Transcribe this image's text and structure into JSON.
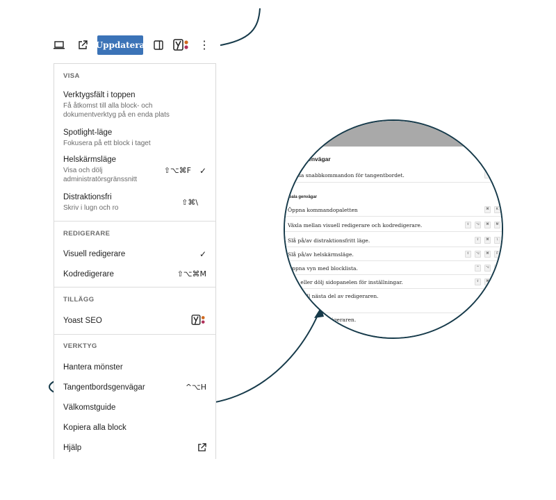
{
  "toolbar": {
    "preview_icon": "laptop-icon",
    "external_icon": "external-link-icon",
    "update_label": "Uppdatera",
    "sidebar_icon": "sidebar-toggle-icon",
    "yoast_icon": "yoast-icon",
    "more_icon": "vertical-ellipsis-icon"
  },
  "menu": {
    "visa": {
      "heading": "VISA",
      "items": [
        {
          "label": "Verktygsfält i toppen",
          "desc": "Få åtkomst till alla block- och dokumentverktyg på en enda plats",
          "shortcut": ""
        },
        {
          "label": "Spotlight-läge",
          "desc": "Fokusera på ett block i taget",
          "shortcut": ""
        },
        {
          "label": "Helskärmsläge",
          "desc": "Visa och dölj administratörsgränssnitt",
          "shortcut": "⇧⌥⌘F",
          "check": "✓"
        },
        {
          "label": "Distraktionsfri",
          "desc": "Skriv i lugn och ro",
          "shortcut": "⇧⌘\\"
        }
      ]
    },
    "redigerare": {
      "heading": "REDIGERARE",
      "items": [
        {
          "label": "Visuell redigerare",
          "shortcut": "✓"
        },
        {
          "label": "Kodredigerare",
          "shortcut": "⇧⌥⌘M"
        }
      ]
    },
    "tillagg": {
      "heading": "TILLÄGG",
      "items": [
        {
          "label": "Yoast SEO",
          "icon": "yoast-icon"
        }
      ]
    },
    "verktyg": {
      "heading": "VERKTYG",
      "items": [
        {
          "label": "Hantera mönster",
          "shortcut": ""
        },
        {
          "label": "Tangentbordsgenvägar",
          "shortcut": "^⌥H"
        },
        {
          "label": "Välkomstguide",
          "shortcut": ""
        },
        {
          "label": "Kopiera alla block",
          "shortcut": ""
        },
        {
          "label": "Hjälp",
          "icon": "external-link-icon"
        }
      ]
    }
  },
  "zoom": {
    "title": "dsgenvägar",
    "subtitle": "dessa snabbkommandon för tangentbordet.",
    "section": "obala genvägar",
    "rows": [
      {
        "text": "Öppna kommandopaletten",
        "keys": [
          "⌘",
          "K"
        ]
      },
      {
        "text": "Växla mellan visuell redigerare och kodredigerare.",
        "keys": [
          "⇧",
          "⌥",
          "⌘",
          "M"
        ]
      },
      {
        "text": "Slå på/av distraktionsfritt läge.",
        "keys": [
          "⇧",
          "⌘",
          "\\"
        ]
      },
      {
        "text": "Slå på/av helskärmsläge.",
        "keys": [
          "⇧",
          "⌥",
          "⌘",
          "F"
        ]
      },
      {
        "text": "Öppna vyn med blocklista.",
        "keys": [
          "^",
          "⌥",
          "O"
        ]
      },
      {
        "text": "Visa eller dölj sidopanelen för inställningar.",
        "keys": [
          "⇧",
          "⌘",
          ","
        ]
      },
      {
        "text": "igera till nästa del av redigeraren.",
        "keys": [
          "^"
        ]
      },
      {
        "text": "ående del av redigeraren.",
        "keys": []
      }
    ]
  },
  "colors": {
    "accent": "#3b73b7",
    "annotation": "#163a4a"
  }
}
